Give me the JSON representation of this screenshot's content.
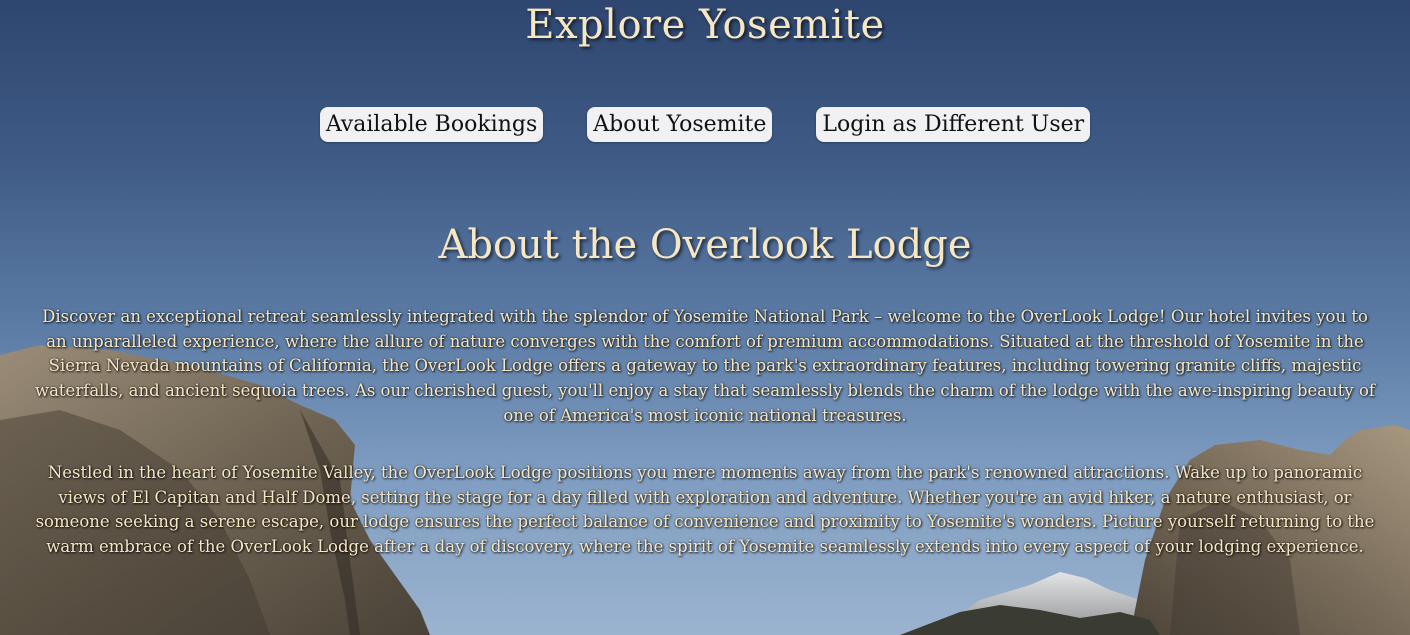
{
  "header": {
    "title": "Explore Yosemite"
  },
  "nav": {
    "bookings_label": "Available Bookings",
    "about_label": "About Yosemite",
    "login_label": "Login as Different User"
  },
  "about": {
    "heading": "About the Overlook Lodge",
    "paragraphs": [
      "Discover an exceptional retreat seamlessly integrated with the splendor of Yosemite National Park – welcome to the OverLook Lodge! Our hotel invites you to an unparalleled experience, where the allure of nature converges with the comfort of premium accommodations. Situated at the threshold of Yosemite in the Sierra Nevada mountains of California, the OverLook Lodge offers a gateway to the park's extraordinary features, including towering granite cliffs, majestic waterfalls, and ancient sequoia trees. As our cherished guest, you'll enjoy a stay that seamlessly blends the charm of the lodge with the awe-inspiring beauty of one of America's most iconic national treasures.",
      "Nestled in the heart of Yosemite Valley, the OverLook Lodge positions you mere moments away from the park's renowned attractions. Wake up to panoramic views of El Capitan and Half Dome, setting the stage for a day filled with exploration and adventure. Whether you're an avid hiker, a nature enthusiast, or someone seeking a serene escape, our lodge ensures the perfect balance of convenience and proximity to Yosemite's wonders. Picture yourself returning to the warm embrace of the OverLook Lodge after a day of discovery, where the spirit of Yosemite seamlessly extends into every aspect of your lodging experience."
    ]
  },
  "theme": {
    "text_color": "#f5e6c4",
    "sky_top": "#2e4670",
    "sky_bottom": "#9bb3cf",
    "button_bg": "#f1f1f3"
  }
}
